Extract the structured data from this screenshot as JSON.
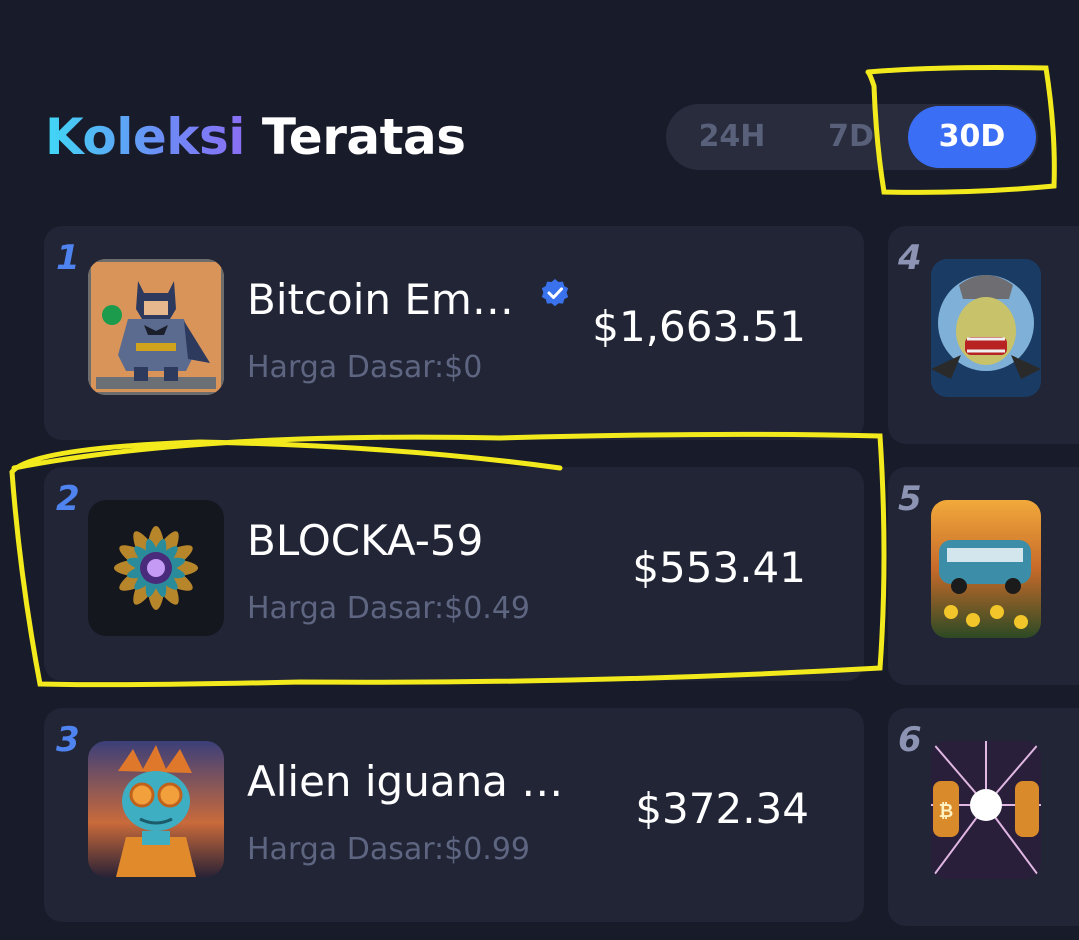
{
  "header": {
    "title_accent": "Koleksi",
    "title_rest": "Teratas"
  },
  "period_tabs": [
    {
      "label": "24H",
      "selected": false
    },
    {
      "label": "7D",
      "selected": false
    },
    {
      "label": "30D",
      "selected": true
    }
  ],
  "collections": [
    {
      "rank": "1",
      "name": "Bitcoin Em…",
      "verified": true,
      "floor": "Harga Dasar:$0",
      "volume": "$1,663.51",
      "thumb_icon": "batman-nft-thumbnail"
    },
    {
      "rank": "2",
      "name": "BLOCKA-59",
      "verified": false,
      "floor": "Harga Dasar:$0.49",
      "volume": "$553.41",
      "thumb_icon": "fractal-flower-nft-thumbnail"
    },
    {
      "rank": "3",
      "name": "Alien iguana …",
      "verified": false,
      "floor": "Harga Dasar:$0.99",
      "volume": "$372.34",
      "thumb_icon": "alien-iguana-nft-thumbnail"
    }
  ],
  "side_collections": [
    {
      "rank": "4",
      "thumb_icon": "ape-nft-thumbnail"
    },
    {
      "rank": "5",
      "thumb_icon": "bus-sunset-nft-thumbnail"
    },
    {
      "rank": "6",
      "thumb_icon": "bitcoin-portal-nft-thumbnail"
    }
  ],
  "colors": {
    "background": "#181b29",
    "card": "#212536",
    "accent_blue": "#3a6ff5",
    "rank_blue": "#4f84f0",
    "annotation_yellow": "#f2ea1c"
  }
}
